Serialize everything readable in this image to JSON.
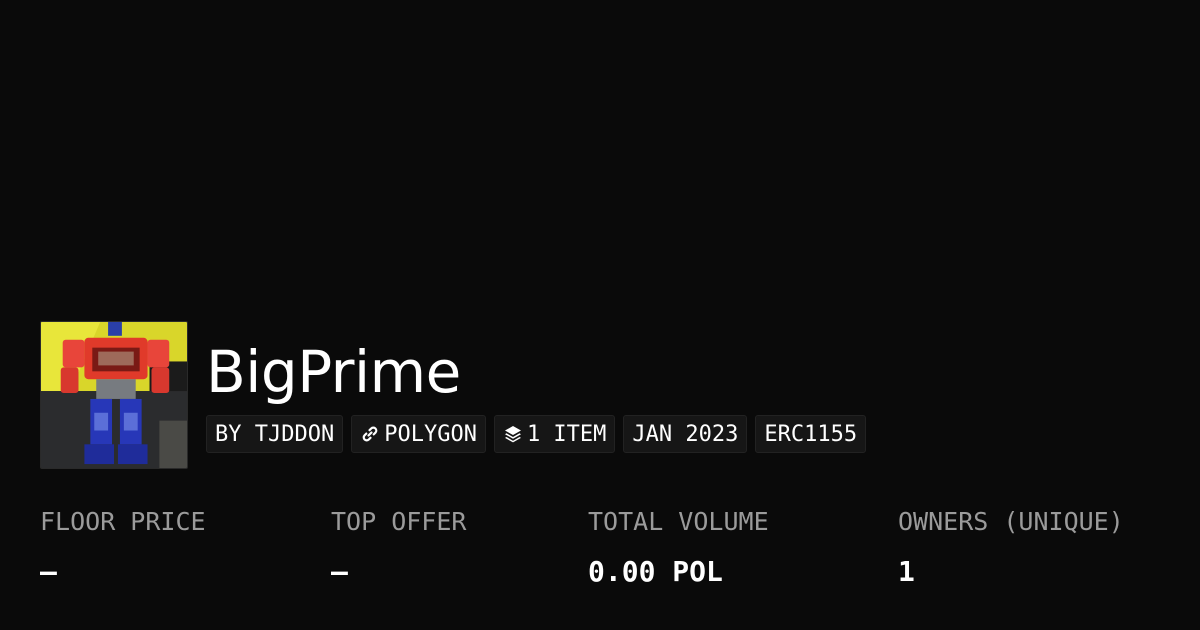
{
  "collection": {
    "title": "BigPrime",
    "thumbnail": "robot-figure-image"
  },
  "tags": [
    {
      "label": "BY TJDDON",
      "icon": null
    },
    {
      "label": "POLYGON",
      "icon": "chain-link-icon"
    },
    {
      "label": "1 ITEM",
      "icon": "layers-icon"
    },
    {
      "label": "JAN 2023",
      "icon": null
    },
    {
      "label": "ERC1155",
      "icon": null
    }
  ],
  "stats": [
    {
      "label": "FLOOR PRICE",
      "value": "–"
    },
    {
      "label": "TOP OFFER",
      "value": "–"
    },
    {
      "label": "TOTAL VOLUME",
      "value": "0.00 POL"
    },
    {
      "label": "OWNERS (UNIQUE)",
      "value": "1"
    }
  ],
  "colors": {
    "background": "#0a0a0a",
    "tag_background": "#161616",
    "label_gray": "#9b9b9b",
    "text": "#ffffff"
  }
}
